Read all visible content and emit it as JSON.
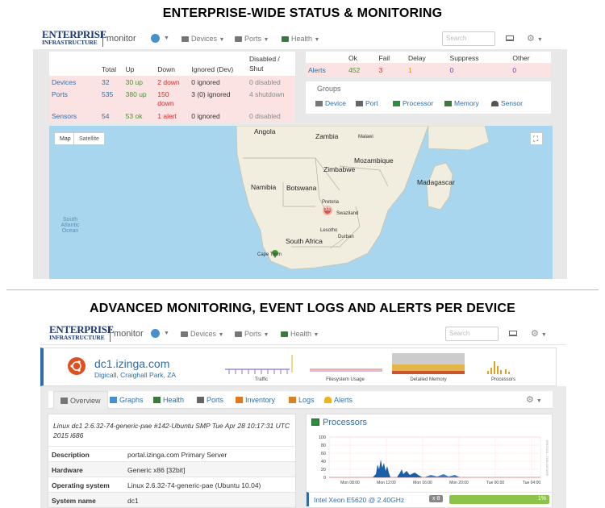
{
  "headings": {
    "top": "ENTERPRISE-WIDE STATUS & MONITORING",
    "bottom": "ADVANCED MONITORING, EVENT LOGS AND ALERTS PER DEVICE"
  },
  "brand": {
    "line1": "ENTERPRISE",
    "line2": "INFRASTRUCTURE",
    "app": "monitor"
  },
  "nav": {
    "devices": "Devices",
    "ports": "Ports",
    "health": "Health",
    "search_placeholder": "Search"
  },
  "status": {
    "headers": [
      "Total",
      "Up",
      "Down",
      "Ignored (Dev)",
      "Disabled / Shut"
    ],
    "rows": [
      {
        "label": "Devices",
        "total": "32",
        "up": "30 up",
        "down": "2 down",
        "ignored": "0 ignored",
        "disabled": "0 disabled"
      },
      {
        "label": "Ports",
        "total": "535",
        "up": "380 up",
        "down": "150 down",
        "ignored": "3 (0) ignored",
        "disabled": "4 shutdown"
      },
      {
        "label": "Sensors",
        "total": "54",
        "up": "53 ok",
        "down": "1 alert",
        "ignored": "0 ignored",
        "disabled": "0 disabled"
      }
    ]
  },
  "alerts": {
    "headers": [
      "Ok",
      "Fail",
      "Delay",
      "Suppress",
      "Other"
    ],
    "label": "Alerts",
    "values": [
      "452",
      "3",
      "1",
      "0",
      "0"
    ]
  },
  "groups": {
    "title": "Groups",
    "items": [
      "Device",
      "Port",
      "Processor",
      "Memory",
      "Sensor"
    ]
  },
  "map": {
    "map_button": "Map",
    "satellite_button": "Satellite",
    "labels": {
      "angola": "Angola",
      "zambia": "Zambia",
      "malawi": "Malawi",
      "zimbabwe": "Zimbabwe",
      "mozambique": "Mozambique",
      "namibia": "Namibia",
      "botswana": "Botswana",
      "madagascar": "Madagascar",
      "pretoria": "Pretoria",
      "swaziland": "Swaziland",
      "lesotho": "Lesotho",
      "durban": "Durban",
      "south_africa": "South Africa",
      "cape_town": "Cape Town",
      "ocean": "South Atlantic Ocean"
    },
    "cluster_count": "31"
  },
  "device": {
    "name": "dc1.izinga.com",
    "location": "Digicall, Craighall Park, ZA",
    "mini_graphs": [
      "Traffic",
      "Filesystem Usage",
      "Detailed Memory",
      "Processors"
    ],
    "tabs": [
      "Overview",
      "Graphs",
      "Health",
      "Ports",
      "Inventory",
      "Logs",
      "Alerts"
    ],
    "kernel": "Linux dc1 2.6.32-74-generic-pae #142-Ubuntu SMP Tue Apr 28 10:17:31 UTC 2015 i686",
    "info": [
      {
        "k": "Description",
        "v": "portal.izinga.com Primary Server"
      },
      {
        "k": "Hardware",
        "v": "Generic x86 [32bit]"
      },
      {
        "k": "Operating system",
        "v": "Linux 2.6.32-74-generic-pae (Ubuntu 10.04)"
      },
      {
        "k": "System name",
        "v": "dc1"
      }
    ],
    "processors": {
      "title": "Processors",
      "y_ticks": [
        "100",
        "80",
        "60",
        "40",
        "20",
        "0"
      ],
      "x_ticks": [
        "Mon 08:00",
        "Mon 12:00",
        "Mon 16:00",
        "Mon 20:00",
        "Tue 00:00",
        "Tue 04:00"
      ],
      "side_label": "RRDTOOL / TOBI OETIKER",
      "cpu_name": "Intel Xeon E5620 @ 2.40GHz",
      "cpu_count": "x 8",
      "cpu_usage": "1%",
      "cpu_usage_fraction": 0.01
    }
  },
  "colors": {
    "link_blue": "#2f6da8",
    "up_green": "#3a9a2a",
    "down_red": "#d42b2b",
    "brand_navy": "#1e3a6e",
    "map_water": "#a8d6ee",
    "map_land": "#f2eedf",
    "cpu_bar_green": "#8cc34a"
  }
}
